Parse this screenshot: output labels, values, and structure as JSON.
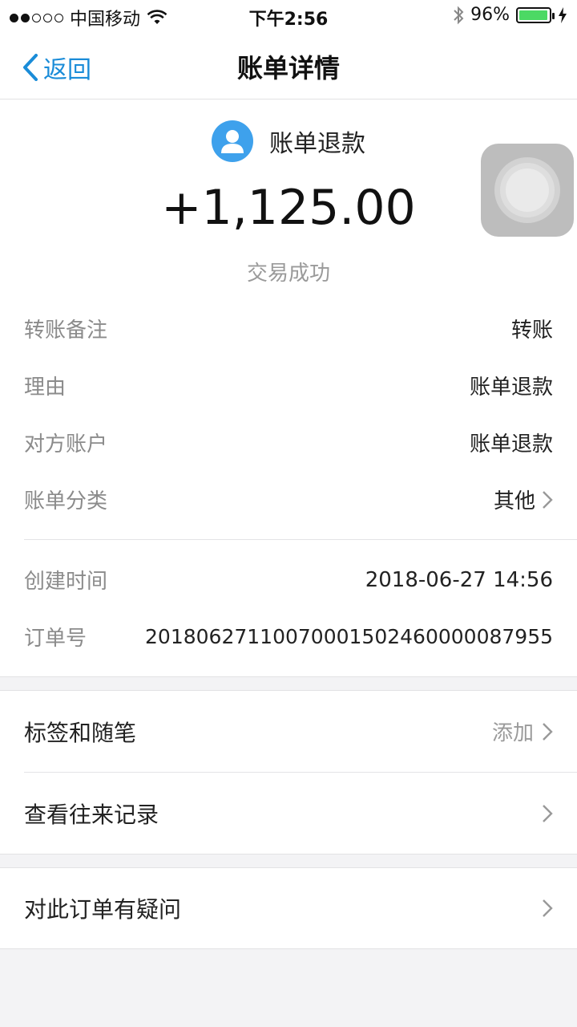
{
  "status_bar": {
    "carrier": "中国移动",
    "time": "下午2:56",
    "battery_percent": "96%",
    "battery_level": 0.96,
    "icons": [
      "wifi-icon",
      "bluetooth-icon",
      "battery-icon",
      "charging-icon"
    ]
  },
  "nav": {
    "back_label": "返回",
    "title": "账单详情"
  },
  "hero": {
    "name": "账单退款",
    "amount": "+1,125.00",
    "status": "交易成功",
    "icon": "user-avatar-icon"
  },
  "details": [
    {
      "label": "转账备注",
      "value": "转账"
    },
    {
      "label": "理由",
      "value": "账单退款"
    },
    {
      "label": "对方账户",
      "value": "账单退款"
    },
    {
      "label": "账单分类",
      "value": "其他"
    }
  ],
  "meta": [
    {
      "label": "创建时间",
      "value": "2018-06-27 14:56"
    },
    {
      "label": "订单号",
      "value": "20180627110070001502460000087955"
    }
  ],
  "menu": {
    "tags_label": "标签和随笔",
    "tags_action": "添加",
    "history_label": "查看往来记录",
    "question_label": "对此订单有疑问"
  },
  "colors": {
    "accent": "#1a8cd8",
    "avatar_bg": "#3ea1ec",
    "battery": "#4cd964"
  }
}
